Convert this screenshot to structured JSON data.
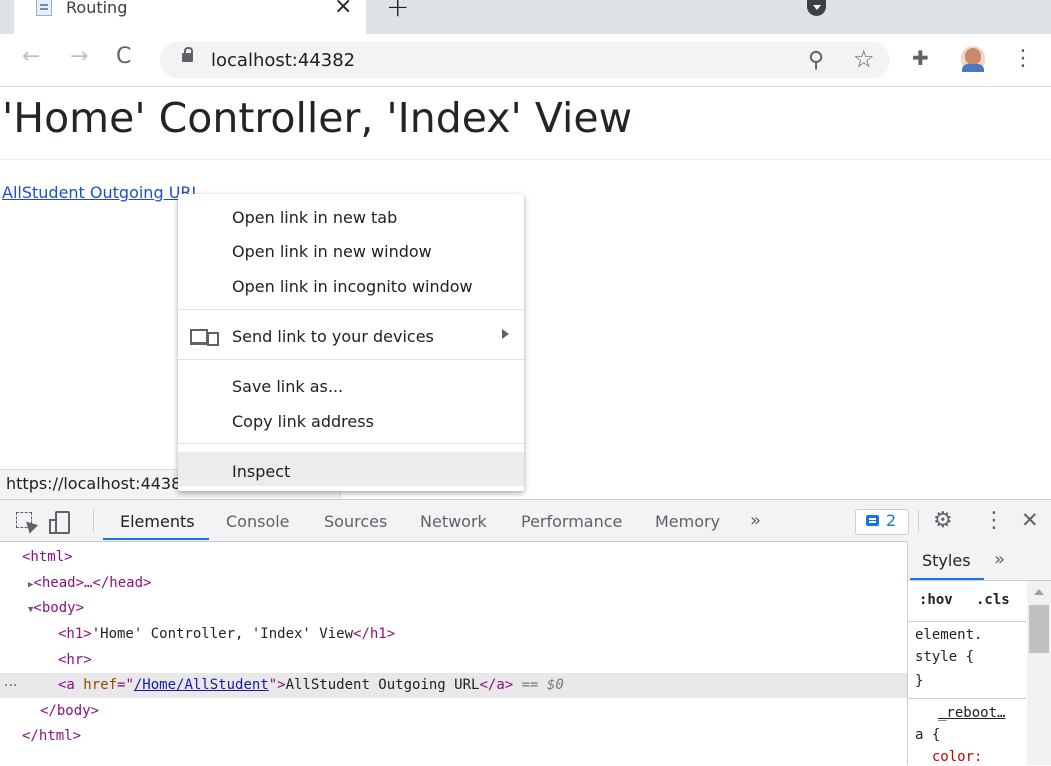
{
  "browser": {
    "tab_title": "Routing",
    "tab_close": "×",
    "new_tab": "+",
    "url": "localhost:44382",
    "nav": {
      "back": "←",
      "forward": "→",
      "reload": "C"
    },
    "icons": {
      "zoom": "⚲",
      "star": "☆",
      "extensions": "✚",
      "menu": "⋮"
    }
  },
  "page": {
    "heading": "'Home' Controller, 'Index' View",
    "link_text": "AllStudent Outgoing URL",
    "status_url": "https://localhost:4438"
  },
  "context_menu": {
    "items": [
      "Open link in new tab",
      "Open link in new window",
      "Open link in incognito window",
      "Send link to your devices",
      "Save link as...",
      "Copy link address",
      "Inspect"
    ]
  },
  "devtools": {
    "tabs": [
      "Elements",
      "Console",
      "Sources",
      "Network",
      "Performance",
      "Memory"
    ],
    "more_tabs": "»",
    "issues_count": "2",
    "tree": {
      "html_open": "<html>",
      "head_collapsed": "<head>…</head>",
      "body_open": "<body>",
      "h1_open": "<h1>",
      "h1_text": "'Home' Controller, 'Index' View",
      "h1_close": "</h1>",
      "hr": "<hr>",
      "a_open_tag": "<a ",
      "a_attr": "href",
      "a_eq": "=\"",
      "a_href": "/Home/AllStudent",
      "a_quote_close": "\">",
      "a_text": "AllStudent Outgoing URL",
      "a_close": "</a>",
      "selected_marker": " == $0",
      "body_close": "</body>",
      "html_close": "</html>",
      "selected_dots": "..."
    },
    "styles": {
      "tab": "Styles",
      "more": "»",
      "hov": ":hov",
      "cls": ".cls",
      "element_line1": "element.",
      "element_line2": "style {",
      "element_close": "}",
      "rule_source": "_reboot…",
      "rule_selector": "a {",
      "rule_prop": "  color:"
    }
  }
}
